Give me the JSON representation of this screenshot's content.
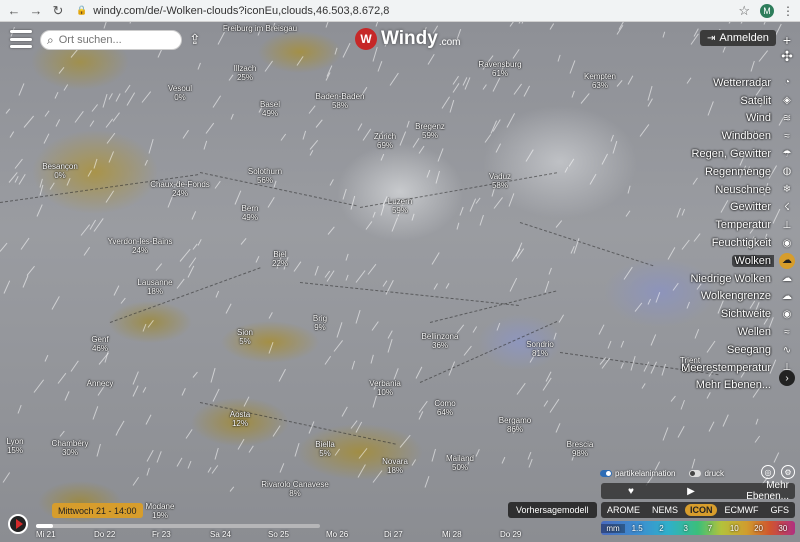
{
  "browser": {
    "url": "windy.com/de/-Wolken-clouds?iconEu,clouds,46.503,8.672,8",
    "avatar_letter": "M"
  },
  "search": {
    "placeholder": "Ort suchen..."
  },
  "logo": {
    "name": "Windy",
    "domain": ".com"
  },
  "login": {
    "label": "Anmelden"
  },
  "layers": [
    {
      "label": "Wetterradar",
      "icon": "radar-icon"
    },
    {
      "label": "Satelit",
      "icon": "satellite-icon"
    },
    {
      "label": "Wind",
      "icon": "wind-icon"
    },
    {
      "label": "Windböen",
      "icon": "gust-icon"
    },
    {
      "label": "Regen, Gewitter",
      "icon": "rain-icon"
    },
    {
      "label": "Regenmenge",
      "icon": "rain-accumulation-icon"
    },
    {
      "label": "Neuschnee",
      "icon": "snowflake-icon"
    },
    {
      "label": "Gewitter",
      "icon": "thunder-icon"
    },
    {
      "label": "Temperatur",
      "icon": "thermometer-icon"
    },
    {
      "label": "Feuchtigkeit",
      "icon": "humidity-icon"
    },
    {
      "label": "Wolken",
      "icon": "cloud-icon",
      "active": true
    },
    {
      "label": "Niedrige Wolken",
      "icon": "low-clouds-icon"
    },
    {
      "label": "Wolkengrenze",
      "icon": "cloud-base-icon"
    },
    {
      "label": "Sichtweite",
      "icon": "eye-icon"
    },
    {
      "label": "Wellen",
      "icon": "waves-icon"
    },
    {
      "label": "Seegang",
      "icon": "swell-icon"
    },
    {
      "label": "Meerestemperatur",
      "icon": "sea-temp-icon"
    },
    {
      "label": "Mehr Ebenen...",
      "icon": "more-layers-icon"
    }
  ],
  "overlay_toggles": {
    "particles": "partikelanimation",
    "pressure": "druck"
  },
  "media_bar": {
    "more_layers": "Mehr Ebenen..."
  },
  "model_label": "Vorhersagemodell",
  "models": [
    "AROME",
    "NEMS",
    "ICON",
    "ECMWF",
    "GFS"
  ],
  "selected_model": "ICON",
  "legend": {
    "unit": "mm",
    "values": [
      "1.5",
      "2",
      "3",
      "7",
      "10",
      "20",
      "30"
    ]
  },
  "timeline": {
    "current": "Mittwoch 21 - 14:00",
    "progress_percent": 6,
    "days": [
      "Mi 21",
      "Do 22",
      "Fr 23",
      "Sa 24",
      "So 25",
      "Mo 26",
      "Di 27",
      "Mi 28",
      "Do 29"
    ]
  },
  "places": [
    {
      "name": "Freiburg im Breisgau",
      "v": ""
    },
    {
      "name": "Ravensburg",
      "v": "61%"
    },
    {
      "name": "Kempten",
      "v": "63%"
    },
    {
      "name": "Illzach",
      "v": "25%"
    },
    {
      "name": "Basel",
      "v": "49%"
    },
    {
      "name": "Vesoul",
      "v": "0%"
    },
    {
      "name": "Zürich",
      "v": "69%"
    },
    {
      "name": "Baden-Baden",
      "v": "58%"
    },
    {
      "name": "Bregenz",
      "v": "59%"
    },
    {
      "name": "Besançon",
      "v": "0%"
    },
    {
      "name": "Chaux-de-Fonds",
      "v": "24%"
    },
    {
      "name": "Solothurn",
      "v": "56%"
    },
    {
      "name": "Luzern",
      "v": "59%"
    },
    {
      "name": "Vaduz",
      "v": "58%"
    },
    {
      "name": "Bern",
      "v": "49%"
    },
    {
      "name": "Yverdon-les-Bains",
      "v": "24%"
    },
    {
      "name": "Lausanne",
      "v": "18%"
    },
    {
      "name": "Biel",
      "v": "22%"
    },
    {
      "name": "Genf",
      "v": "46%"
    },
    {
      "name": "Sion",
      "v": "5%"
    },
    {
      "name": "Brig",
      "v": "9%"
    },
    {
      "name": "Bellinzona",
      "v": "36%"
    },
    {
      "name": "Sondrio",
      "v": "81%"
    },
    {
      "name": "Trient",
      "v": "93%"
    },
    {
      "name": "Annecy",
      "v": ""
    },
    {
      "name": "Verbania",
      "v": "10%"
    },
    {
      "name": "Aosta",
      "v": "12%"
    },
    {
      "name": "Como",
      "v": "64%"
    },
    {
      "name": "Bergamo",
      "v": "86%"
    },
    {
      "name": "Biella",
      "v": "5%"
    },
    {
      "name": "Novara",
      "v": "18%"
    },
    {
      "name": "Mailand",
      "v": "50%"
    },
    {
      "name": "Brescia",
      "v": "98%"
    },
    {
      "name": "Rivarolo Canavese",
      "v": "8%"
    },
    {
      "name": "Chambéry",
      "v": "30%"
    },
    {
      "name": "Lyon",
      "v": "15%"
    },
    {
      "name": "Modane",
      "v": "19%"
    }
  ]
}
